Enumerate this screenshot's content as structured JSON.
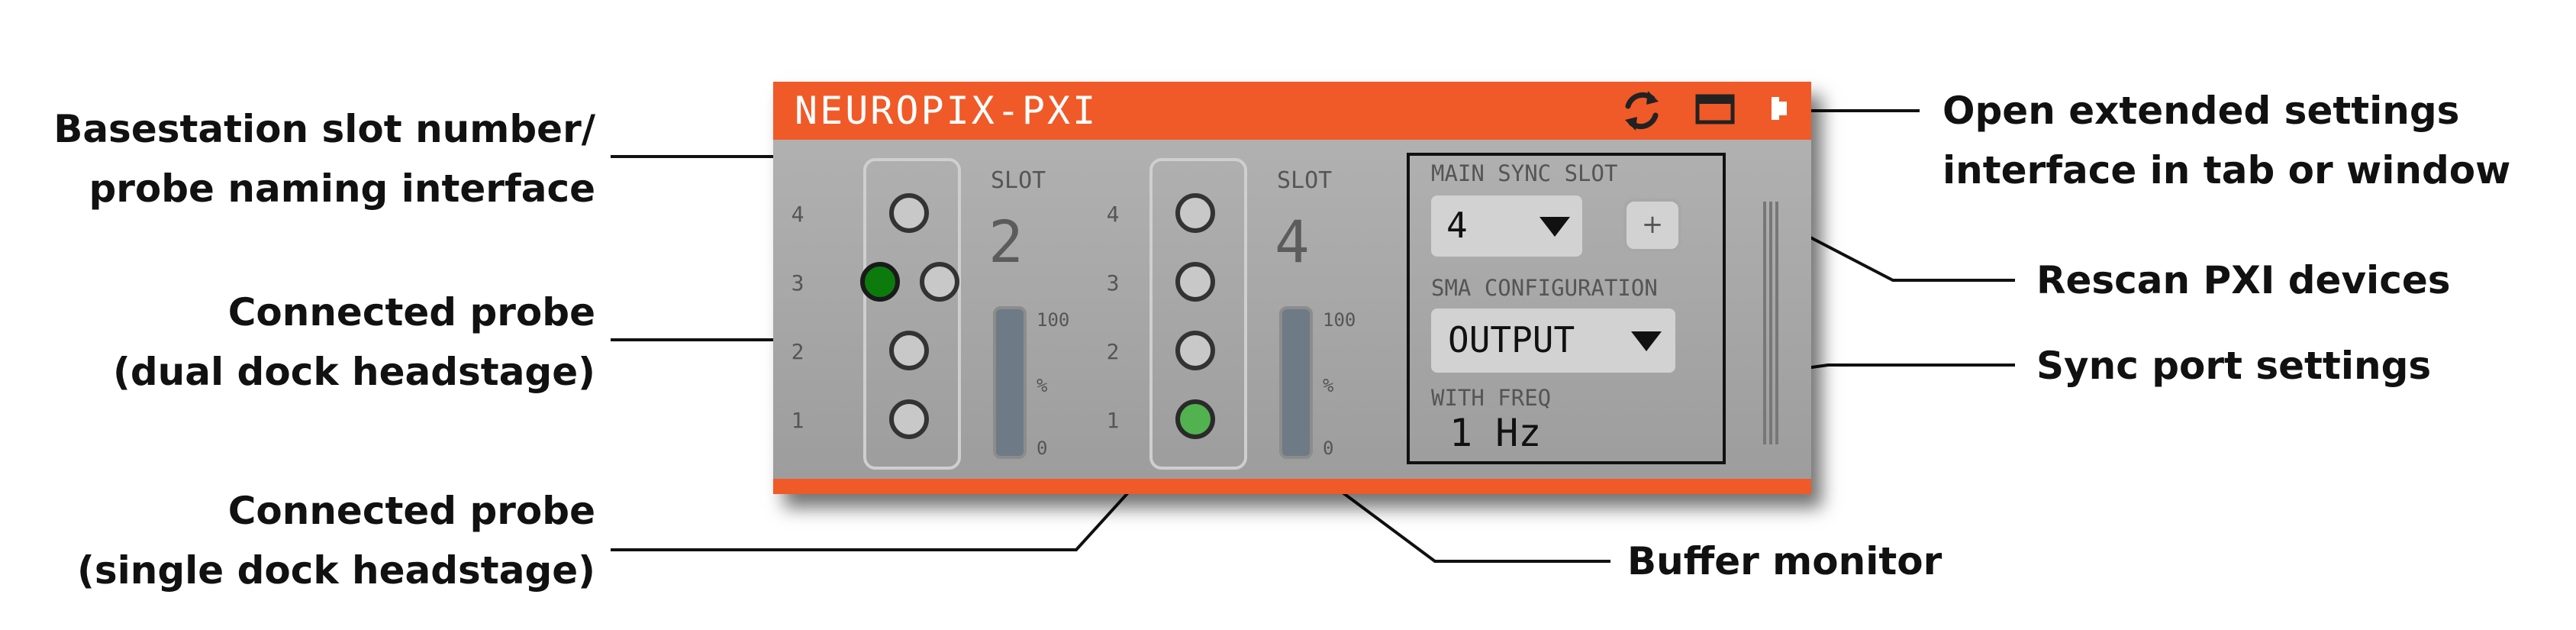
{
  "panel": {
    "title": "NEUROPIX-PXI",
    "colors": {
      "accent": "#f05a28",
      "panel": "#a8a8a8",
      "dual_probe": "#0d7a0d",
      "single_probe": "#52b24f"
    },
    "icons": [
      "rescan-icon",
      "window-icon",
      "tab-icon"
    ],
    "row_labels": [
      "4",
      "3",
      "2",
      "1"
    ],
    "slot_label": "SLOT",
    "slots": [
      {
        "number": "2",
        "buffer_max": "100",
        "buffer_unit": "%",
        "buffer_min": "0",
        "buffer_level": 0.0
      },
      {
        "number": "4",
        "buffer_max": "100",
        "buffer_unit": "%",
        "buffer_min": "0",
        "buffer_level": 0.0
      }
    ],
    "sync": {
      "main_sync_slot_label": "MAIN SYNC SLOT",
      "main_sync_slot_value": "4",
      "add_button_label": "+",
      "sma_label": "SMA CONFIGURATION",
      "sma_value": "OUTPUT",
      "freq_label": "WITH FREQ",
      "freq_value": "1 Hz"
    }
  },
  "annotations": {
    "slot_naming": [
      "Basestation slot number/",
      "probe naming interface"
    ],
    "dual_probe": [
      "Connected probe",
      "(dual dock headstage)"
    ],
    "single_probe": [
      "Connected probe",
      "(single dock headstage)"
    ],
    "extended_settings": [
      "Open extended settings",
      "interface in tab or window"
    ],
    "rescan": "Rescan PXI devices",
    "sync_settings": "Sync port settings",
    "buffer_monitor": "Buffer monitor"
  }
}
